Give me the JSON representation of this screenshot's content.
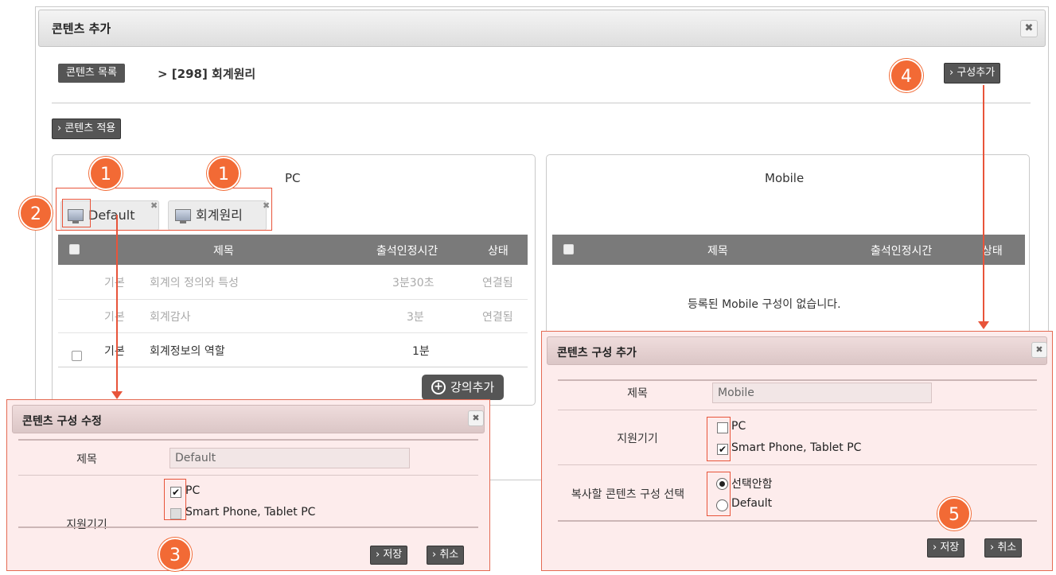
{
  "main": {
    "title": "콘텐츠 추가",
    "close": "✖",
    "breadcrumb_tag": "콘텐츠 목록",
    "breadcrumb_text": "> [298] 회계원리",
    "add_config_btn": "› 구성추가",
    "apply_btn": "› 콘텐츠 적용"
  },
  "pc_panel": {
    "title": "PC",
    "tags": [
      {
        "label": "Default",
        "close": "✖"
      },
      {
        "label": "회계원리",
        "close": "✖"
      }
    ],
    "columns": [
      "제목",
      "출석인정시간",
      "상태"
    ],
    "rows": [
      {
        "type": "기본",
        "title": "회계의 정의와 특성",
        "time": "3분30초",
        "status": "연결됨"
      },
      {
        "type": "기본",
        "title": "회계감사",
        "time": "3분",
        "status": "연결됨"
      },
      {
        "type": "기본",
        "title": "회계정보의 역할",
        "time": "1분",
        "status": ""
      }
    ],
    "add_lecture_btn": "강의추가"
  },
  "mobile_panel": {
    "title": "Mobile",
    "columns": [
      "제목",
      "출석인정시간",
      "상태"
    ],
    "empty": "등록된 Mobile 구성이 없습니다."
  },
  "edit_dialog": {
    "title": "콘텐츠 구성 수정",
    "close": "✖",
    "title_label": "제목",
    "title_value": "Default",
    "device_label": "지원기기",
    "devices": [
      {
        "label": "PC",
        "checked": true
      },
      {
        "label": "Smart Phone, Tablet PC",
        "checked": false
      }
    ],
    "save_btn": "› 저장",
    "cancel_btn": "› 취소"
  },
  "add_dialog": {
    "title": "콘텐츠 구성 추가",
    "close": "✖",
    "title_label": "제목",
    "title_value": "Mobile",
    "device_label": "지원기기",
    "devices": [
      {
        "label": "PC",
        "checked": false
      },
      {
        "label": "Smart Phone, Tablet PC",
        "checked": true
      }
    ],
    "copy_label": "복사할 콘텐츠 구성 선택",
    "copy_options": [
      {
        "label": "선택안함",
        "selected": true
      },
      {
        "label": "Default",
        "selected": false
      }
    ],
    "save_btn": "› 저장",
    "cancel_btn": "› 취소"
  },
  "annotations": {
    "badges": [
      "1",
      "1",
      "2",
      "3",
      "4",
      "5"
    ],
    "color": "#f26a35"
  }
}
